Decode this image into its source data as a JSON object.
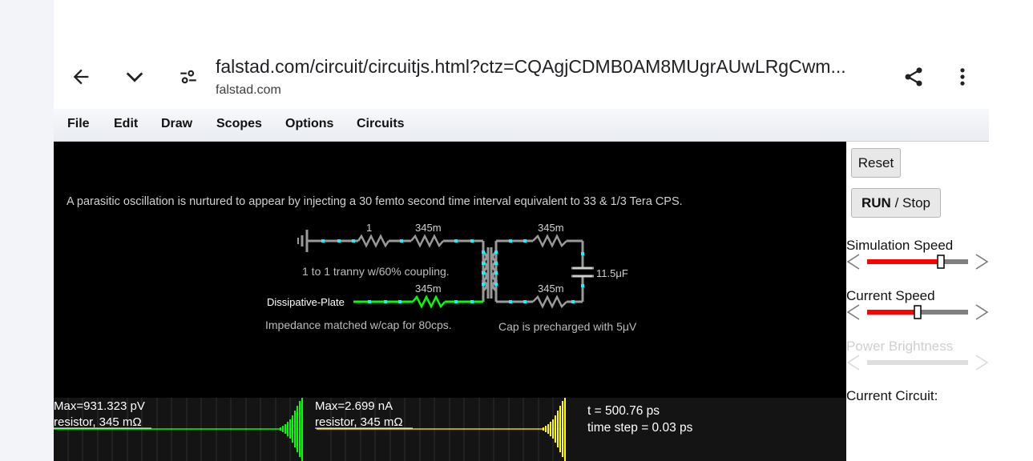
{
  "browser": {
    "url": "falstad.com/circuit/circuitjs.html?ctz=CQAgjCDMB0AM8MUgrAUwLRgCwm...",
    "domain": "falstad.com",
    "icons": [
      "back-arrow-icon",
      "chevron-down-icon",
      "site-settings-icon",
      "share-icon",
      "more-vert-icon"
    ]
  },
  "menu": {
    "items": [
      "File",
      "Edit",
      "Draw",
      "Scopes",
      "Options",
      "Circuits"
    ]
  },
  "circuit": {
    "title": "A parasitic oscillation is nurtured to appear by injecting a 30 femto second time interval equivalent to 33 & 1/3 Tera CPS.",
    "labels": {
      "r1": "1",
      "r2": "345m",
      "r3": "345m",
      "r4": "345m",
      "r5": "345m",
      "cap": "11.5μF",
      "tranny": "1 to 1 tranny w/60% coupling.",
      "plate": "Dissipative-Plate",
      "impedance": "Impedance matched w/cap for 80cps.",
      "precharge": "Cap is precharged with 5μV"
    },
    "colors": {
      "wire": "#9a9a9a",
      "active": "#00ff00",
      "node": "#00ffff"
    }
  },
  "scopes": [
    {
      "max": "Max=931.323 pV",
      "name": "resistor, 345 mΩ",
      "color": "#00ff00"
    },
    {
      "max": "Max=2.699 nA",
      "name": "resistor, 345 mΩ",
      "color": "#ffff00"
    }
  ],
  "status": {
    "time": "t = 500.76 ps",
    "step": "time step = 0.03 ps"
  },
  "sidebar": {
    "reset": "Reset",
    "run": "RUN",
    "sep": " / ",
    "stop": "Stop",
    "sim_speed_label": "Simulation Speed",
    "sim_speed_level": 0.73,
    "current_speed_label": "Current Speed",
    "current_speed_level": 0.5,
    "power_label": "Power Brightness",
    "current_circuit_label": "Current Circuit:"
  }
}
